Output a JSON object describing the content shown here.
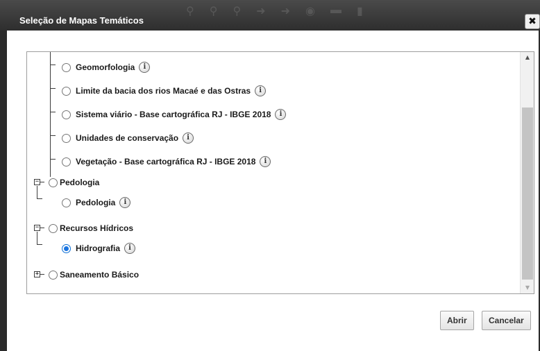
{
  "window": {
    "title": "Seleção de Mapas Temáticos",
    "close_label": "✖"
  },
  "tree": {
    "items": [
      {
        "label": "Geomorfologia",
        "checked": false
      },
      {
        "label": "Limite da bacia dos rios Macaé e das Ostras",
        "checked": false
      },
      {
        "label": "Sistema viário - Base cartográfica RJ - IBGE 2018",
        "checked": false
      },
      {
        "label": "Unidades de conservação",
        "checked": false
      },
      {
        "label": "Vegetação - Base cartográfica RJ - IBGE 2018",
        "checked": false
      }
    ],
    "groups": [
      {
        "label": "Pedologia",
        "expanded": true,
        "children": [
          {
            "label": "Pedologia",
            "checked": false
          }
        ]
      },
      {
        "label": "Recursos Hídricos",
        "expanded": true,
        "children": [
          {
            "label": "Hidrografia",
            "checked": true
          }
        ]
      },
      {
        "label": "Saneamento Básico",
        "expanded": false,
        "children": []
      }
    ],
    "expander_expanded_symbol": "−",
    "expander_collapsed_symbol": "+",
    "info_symbol": "i"
  },
  "scrollbar": {
    "up_arrow": "▲",
    "down_arrow": "▼"
  },
  "buttons": {
    "open_label": "Abrir",
    "cancel_label": "Cancelar"
  }
}
